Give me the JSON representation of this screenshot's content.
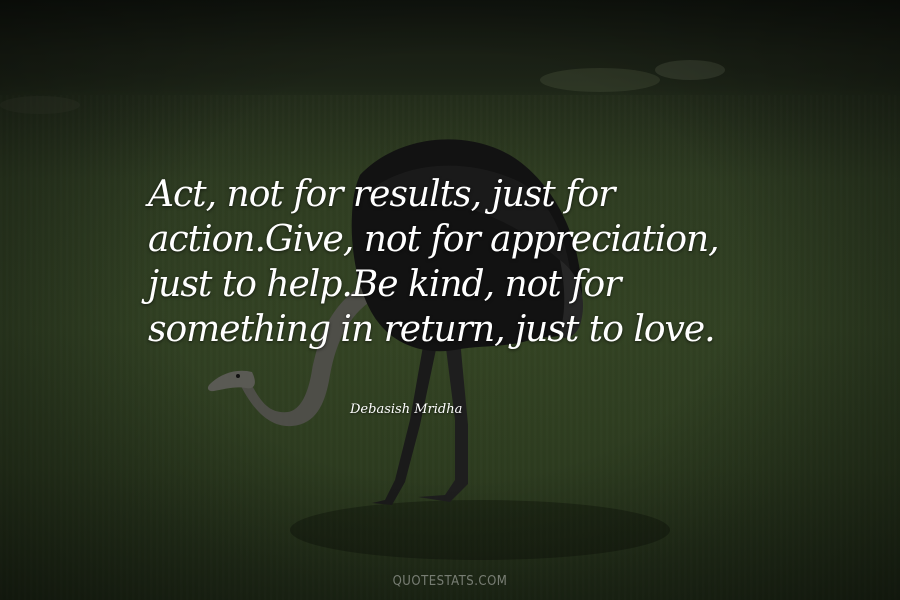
{
  "quote": {
    "text": "Act, not for results, just for action.Give, not for appreciation, just to help.Be kind, not for something in return, just to love.",
    "author": "Debasish Mridha"
  },
  "watermark": {
    "site": "QUOTESTATS.COM"
  },
  "colors": {
    "quote_text": "#ffffff",
    "grass": "#2f3e22",
    "ostrich_body": "#121212"
  },
  "scene": {
    "subject": "ostrich-grazing-on-grass"
  }
}
